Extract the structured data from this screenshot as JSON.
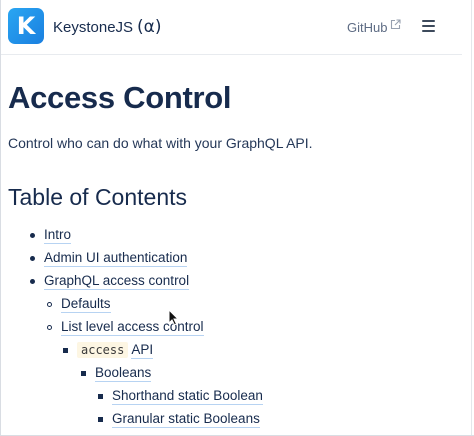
{
  "header": {
    "logo_letter": "K",
    "brand_name": "KeystoneJS",
    "brand_suffix": "(α)",
    "github_label": "GitHub",
    "menu_icon": "hamburger-menu-icon",
    "external_icon": "external-link-icon"
  },
  "main": {
    "title": "Access Control",
    "intro": "Control who can do what with your GraphQL API.",
    "toc_heading": "Table of Contents",
    "toc": [
      {
        "label": "Intro",
        "level": 1
      },
      {
        "label": "Admin UI authentication",
        "level": 1
      },
      {
        "label": "GraphQL access control",
        "level": 1
      },
      {
        "label": "Defaults",
        "level": 2
      },
      {
        "label": "List level access control",
        "level": 2
      },
      {
        "code": "access",
        "label": "API",
        "level": 3
      },
      {
        "label": "Booleans",
        "level": 4
      },
      {
        "label": "Shorthand static Boolean",
        "level": 5
      },
      {
        "label": "Granular static Booleans",
        "level": 5
      }
    ]
  },
  "colors": {
    "brand_blue": "#1a7fe0",
    "text": "#172b4d",
    "link_underline": "#b7d3f2",
    "code_background": "#fdf6e3"
  }
}
